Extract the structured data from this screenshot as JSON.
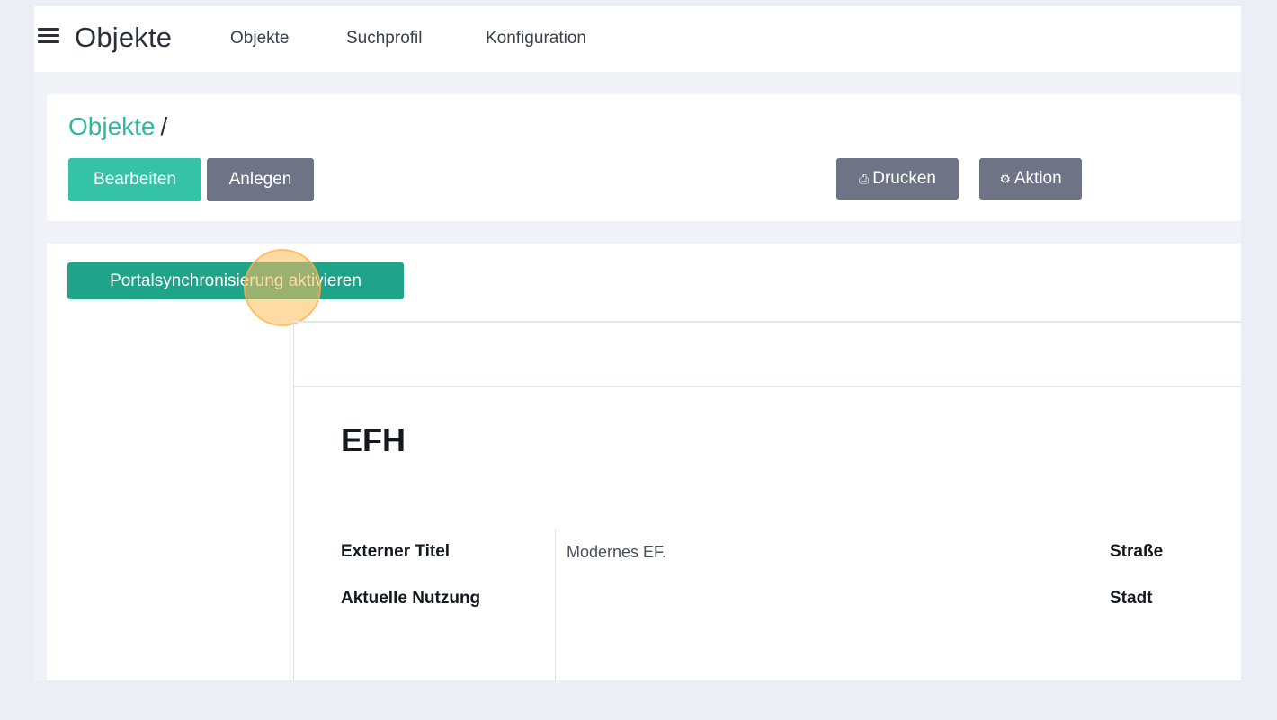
{
  "navbar": {
    "brand": "Objekte",
    "items": [
      "Objekte",
      "Suchprofil",
      "Konfiguration"
    ]
  },
  "header": {
    "breadcrumb_link": "Objekte",
    "breadcrumb_sep": "/",
    "edit_label": "Bearbeiten",
    "create_label": "Anlegen",
    "print_label": "Drucken",
    "action_label": "Aktion"
  },
  "content": {
    "sync_button": "Portalsynchronisierung aktivieren",
    "object_title": "EFH",
    "details": {
      "external_title_label": "Externer Titel",
      "external_title_value": "Modernes EF.",
      "usage_label": "Aktuelle Nutzung",
      "street_label": "Straße",
      "city_label": "Stadt"
    }
  },
  "colors": {
    "accent": "#34c3a6",
    "accent_dark": "#1fa389",
    "secondary": "#6e7385"
  },
  "icons": [
    "menu-icon",
    "print-icon",
    "gear-icon"
  ]
}
